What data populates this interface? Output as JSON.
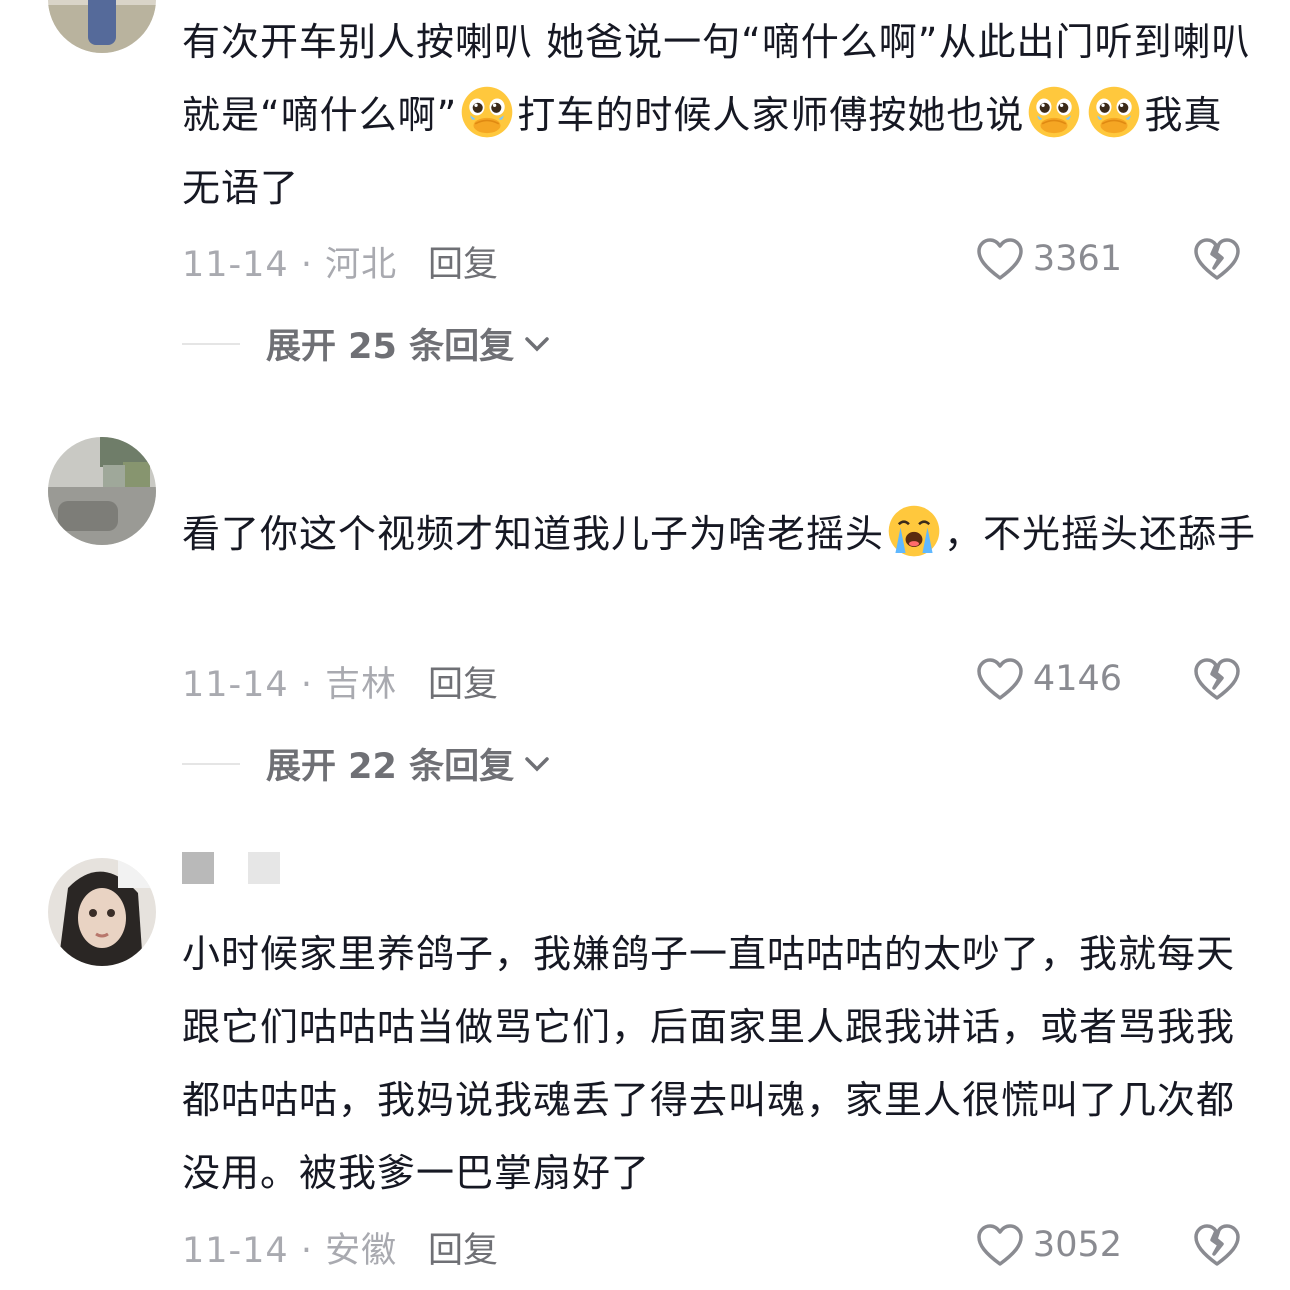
{
  "comments": [
    {
      "text_parts": [
        "有次开车别人按喇叭 她爸说一句“嘀什么啊”从此出门听到喇叭就是“嘀什么啊”",
        "打车的时候人家师傅按她也说",
        "我真无语了"
      ],
      "emoji_icons": [
        "pleading-face-icon",
        "pleading-face-icon",
        "pleading-face-icon"
      ],
      "date_location": "11-14 · 河北",
      "reply_label": "回复",
      "likes": "3361",
      "expand_label": "展开 25 条回复"
    },
    {
      "text_parts": [
        "看了你这个视频才知道我儿子为啥老摇头",
        "，不光摇头还舔手"
      ],
      "emoji_icons": [
        "loudly-crying-face-icon"
      ],
      "date_location": "11-14 · 吉林",
      "reply_label": "回复",
      "likes": "4146",
      "expand_label": "展开 22 条回复"
    },
    {
      "text": "小时候家里养鸽子，我嫌鸽子一直咕咕咕的太吵了，我就每天跟它们咕咕咕当做骂它们，后面家里人跟我讲话，或者骂我我都咕咕咕，我妈说我魂丢了得去叫魂，家里人很慌叫了几次都没用。被我爹一巴掌扇好了",
      "date_location": "11-14 · 安徽",
      "reply_label": "回复",
      "likes": "3052"
    }
  ],
  "colors": {
    "text": "#161823",
    "meta": "#a9aab0",
    "reply": "#6f7075"
  }
}
